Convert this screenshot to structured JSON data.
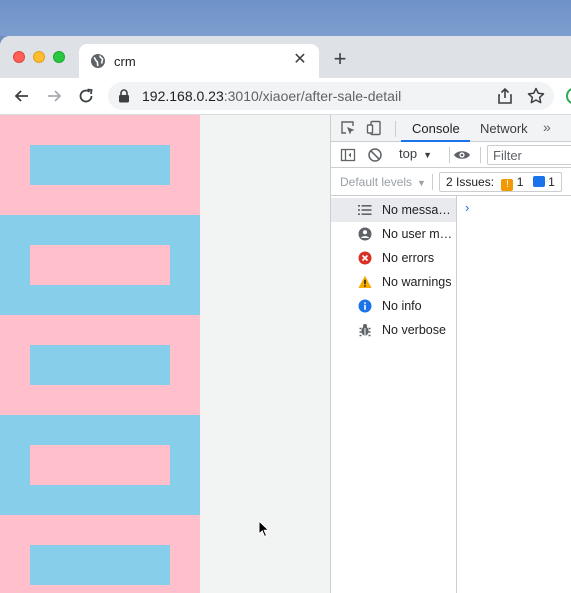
{
  "browser": {
    "tab": {
      "title": "crm",
      "favicon": "globe-icon"
    },
    "url": {
      "host": "192.168.0.23",
      "rest": ":3010/xiaoer/after-sale-detail"
    }
  },
  "page": {
    "stripe_colors": {
      "pink": "#ffc0cb",
      "blue": "#87ceeb"
    }
  },
  "devtools": {
    "tabs": {
      "console": "Console",
      "network": "Network",
      "more": "»"
    },
    "context": "top",
    "filter_placeholder": "Filter",
    "default_levels": "Default levels",
    "issues": {
      "label": "2 Issues:",
      "warnings": "1",
      "info": "1"
    },
    "sidebar": [
      {
        "label": "No messages",
        "icon": "list-icon"
      },
      {
        "label": "No user messages",
        "icon": "user-icon"
      },
      {
        "label": "No errors",
        "icon": "error-icon"
      },
      {
        "label": "No warnings",
        "icon": "warning-icon"
      },
      {
        "label": "No info",
        "icon": "info-icon"
      },
      {
        "label": "No verbose",
        "icon": "bug-icon"
      }
    ],
    "prompt": "›"
  }
}
